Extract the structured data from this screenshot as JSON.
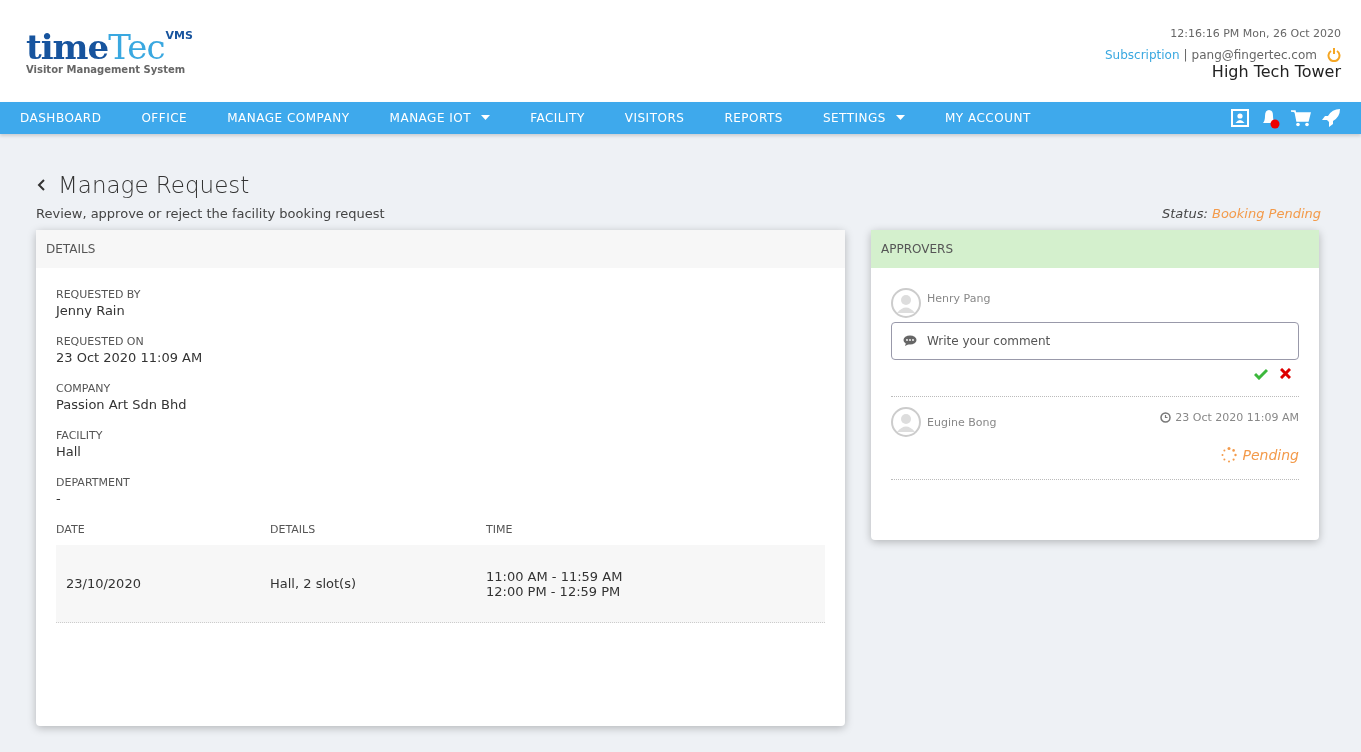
{
  "logo": {
    "word_1": "time",
    "word_2": "Tec",
    "badge": "VMS",
    "tagline": "Visitor Management System"
  },
  "header": {
    "datetime": "12:16:16 PM  Mon, 26 Oct 2020",
    "subscription_link": "Subscription",
    "separator": "|",
    "email": "pang@fingertec.com",
    "building": "High Tech Tower"
  },
  "nav": [
    {
      "label": "DASHBOARD",
      "has_dropdown": false
    },
    {
      "label": "OFFICE",
      "has_dropdown": false
    },
    {
      "label": "MANAGE COMPANY",
      "has_dropdown": false
    },
    {
      "label": "MANAGE IOT",
      "has_dropdown": true
    },
    {
      "label": "FACILITY",
      "has_dropdown": false
    },
    {
      "label": "VISITORS",
      "has_dropdown": false
    },
    {
      "label": "REPORTS",
      "has_dropdown": false
    },
    {
      "label": "SETTINGS",
      "has_dropdown": true
    },
    {
      "label": "MY ACCOUNT",
      "has_dropdown": false
    }
  ],
  "page": {
    "title": "Manage Request",
    "subtitle": "Review, approve or reject the facility booking request",
    "status_label": "Status:",
    "status_value": "Booking Pending"
  },
  "details": {
    "heading": "DETAILS",
    "fields": [
      {
        "label": "REQUESTED BY",
        "value": "Jenny Rain"
      },
      {
        "label": "REQUESTED ON",
        "value": "23 Oct 2020 11:09 AM"
      },
      {
        "label": "COMPANY",
        "value": "Passion Art Sdn Bhd"
      },
      {
        "label": "FACILITY",
        "value": "Hall"
      },
      {
        "label": "DEPARTMENT",
        "value": "-"
      }
    ],
    "table": {
      "columns": [
        "DATE",
        "DETAILS",
        "TIME"
      ],
      "rows": [
        {
          "date": "23/10/2020",
          "details": "Hall, 2 slot(s)",
          "times": [
            "11:00 AM - 11:59 AM",
            "12:00 PM - 12:59 PM"
          ]
        }
      ]
    }
  },
  "approvers": {
    "heading": "APPROVERS",
    "items": [
      {
        "kind": "comment",
        "name": "Henry Pang",
        "placeholder": "Write your comment"
      },
      {
        "kind": "status",
        "name": "Eugine Bong",
        "time": "23 Oct 2020 11:09 AM",
        "status": "Pending"
      }
    ]
  }
}
